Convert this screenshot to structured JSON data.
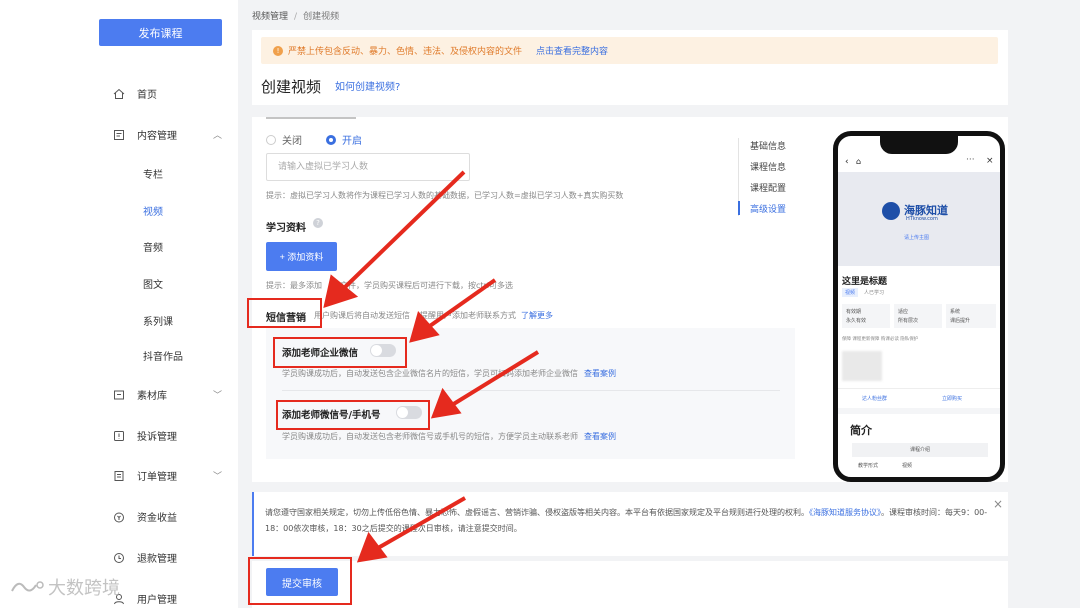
{
  "sidebar": {
    "publish_label": "发布课程",
    "items": [
      {
        "label": "首页",
        "icon": "home-icon"
      },
      {
        "label": "内容管理",
        "icon": "content-icon"
      },
      {
        "label": "素材库",
        "icon": "material-icon"
      },
      {
        "label": "投诉管理",
        "icon": "complaint-icon"
      },
      {
        "label": "订单管理",
        "icon": "order-icon"
      },
      {
        "label": "资金收益",
        "icon": "money-icon"
      },
      {
        "label": "退款管理",
        "icon": "refund-icon"
      },
      {
        "label": "用户管理",
        "icon": "user-icon"
      }
    ],
    "sub_items": [
      "专栏",
      "视频",
      "音频",
      "图文",
      "系列课",
      "抖音作品"
    ],
    "active_sub": "视频"
  },
  "breadcrumb": {
    "parent": "视频管理",
    "separator": "/",
    "current": "创建视频"
  },
  "alert": {
    "text": "严禁上传包含反动、暴力、色情、违法、及侵权内容的文件",
    "link": "点击查看完整内容"
  },
  "page": {
    "title": "创建视频",
    "help_link": "如何创建视频?"
  },
  "virtual": {
    "off_label": "关闭",
    "on_label": "开启",
    "input_placeholder": "请输入虚拟已学习人数",
    "hint": "提示：虚拟已学习人数将作为课程已学习人数的基础数据，已学习人数=虚拟已学习人数+真实购买数"
  },
  "materials": {
    "label": "学习资料",
    "button": "添加资料",
    "hint": "提示：最多添加",
    "hint_tail": "文件，学员购买课程后可进行下载，按ctrl可多选"
  },
  "sms": {
    "label": "短信营销",
    "desc": "用户购课后将自动发送短信",
    "desc_tail": "提醒用户添加老师联系方式",
    "learn_more": "了解更多",
    "options": [
      {
        "label": "添加老师企业微信",
        "desc": "学员购课成功后，自动发送包含企业微信名片的短信，学员可扫码添加老师企业微信",
        "example": "查看案例"
      },
      {
        "label": "添加老师微信号/手机号",
        "desc": "学员购课成功后，自动发送包含老师微信号或手机号的短信，方便学员主动联系老师",
        "example": "查看案例"
      }
    ]
  },
  "toc": {
    "items": [
      "基础信息",
      "课程信息",
      "课程配置",
      "高级设置"
    ],
    "active": "高级设置"
  },
  "phone": {
    "brand": "海豚知道",
    "brand_en": "HTknow.com",
    "upload_hint": "请上传主图",
    "course_title": "这里是标题",
    "tag1": "视频",
    "tag2": "人已学习",
    "features": [
      {
        "title": "有效期",
        "sub": "永久有效"
      },
      {
        "title": "适应",
        "sub": "所有层次"
      },
      {
        "title": "系统",
        "sub": "课后提升"
      }
    ],
    "guarantees": "保障  课程更新保障  购课必读  隐私保护",
    "consult": "达人粉丝群",
    "buy": "立即购买",
    "intro_title": "简介",
    "intro_tab": "课程介绍",
    "intro_col1": "教学形式",
    "intro_col2": "视频"
  },
  "notice": {
    "text": "请您遵守国家相关规定，切勿上传低俗色情、暴力恐怖、虚假谣言、营销诈骗、侵权盗版等相关内容。本平台有依据国家规定及平台规则进行处理的权利。",
    "link": "《海豚知道服务协议》",
    "tail": "。课程审核时间：每天9：00-18：00依次审核，18：30之后提交的课程次日审核，请注意提交时间。"
  },
  "submit_label": "提交审核",
  "watermark": "大数跨境",
  "colors": {
    "accent": "#4c7cf0",
    "annotation": "#e52a1e",
    "alert_bg": "#fdf1e2"
  }
}
